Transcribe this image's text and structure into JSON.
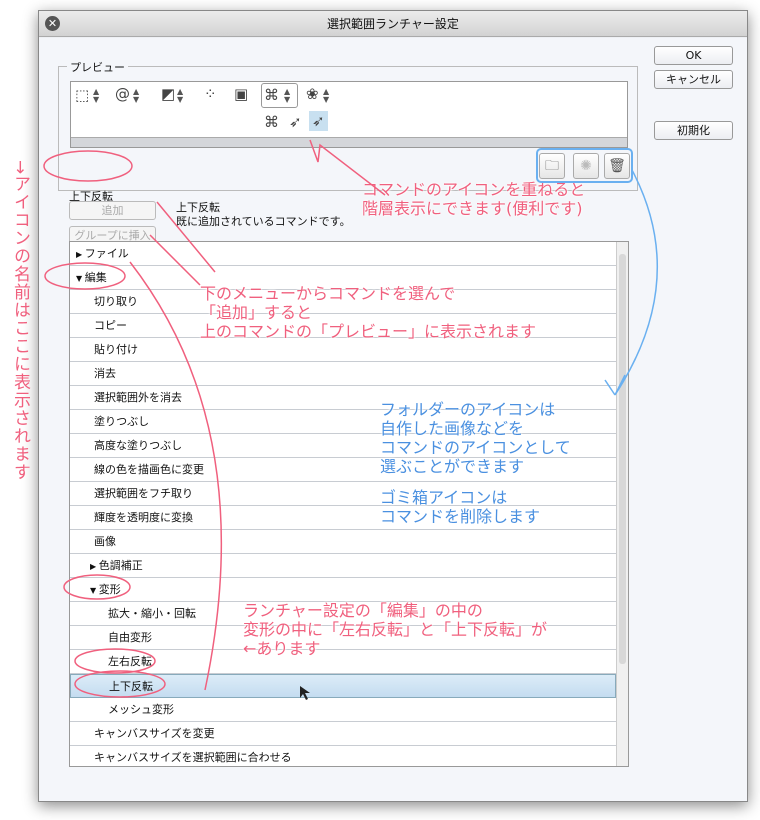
{
  "window": {
    "title": "選択範囲ランチャー設定"
  },
  "buttons": {
    "ok": "OK",
    "cancel": "キャンセル",
    "reset": "初期化",
    "add": "追加",
    "insert_group": "グループに挿入"
  },
  "preview": {
    "label": "プレビュー",
    "selected_name": "上下反転"
  },
  "description": {
    "name": "上下反転",
    "message": "既に追加されているコマンドです。"
  },
  "list": [
    {
      "label": "ファイル",
      "level": 0,
      "arrow": "right"
    },
    {
      "label": "編集",
      "level": 0,
      "arrow": "down"
    },
    {
      "label": "切り取り",
      "level": 1
    },
    {
      "label": "コピー",
      "level": 1
    },
    {
      "label": "貼り付け",
      "level": 1
    },
    {
      "label": "消去",
      "level": 1
    },
    {
      "label": "選択範囲外を消去",
      "level": 1
    },
    {
      "label": "塗りつぶし",
      "level": 1
    },
    {
      "label": "高度な塗りつぶし",
      "level": 1
    },
    {
      "label": "線の色を描画色に変更",
      "level": 1
    },
    {
      "label": "選択範囲をフチ取り",
      "level": 1
    },
    {
      "label": "輝度を透明度に変換",
      "level": 1
    },
    {
      "label": "画像",
      "level": 1
    },
    {
      "label": "色調補正",
      "level": 1,
      "arrow": "right"
    },
    {
      "label": "変形",
      "level": 1,
      "arrow": "down"
    },
    {
      "label": "拡大・縮小・回転",
      "level": 2
    },
    {
      "label": "自由変形",
      "level": 2
    },
    {
      "label": "左右反転",
      "level": 2
    },
    {
      "label": "上下反転",
      "level": 2,
      "selected": true
    },
    {
      "label": "メッシュ変形",
      "level": 2
    },
    {
      "label": "キャンバスサイズを変更",
      "level": 1
    },
    {
      "label": "キャンバスサイズを選択範囲に合わせる",
      "level": 1
    }
  ],
  "annotations": {
    "vertical": "→アイコンの名前はここに表示されます",
    "stack": [
      "コマンドのアイコンを重ねると",
      "階層表示にできます(便利です)"
    ],
    "add": [
      "下のメニューからコマンドを選んで",
      "「追加」すると",
      "上のコマンドの「プレビュー」に表示されます"
    ],
    "folder": [
      "フォルダーのアイコンは",
      "自作した画像などを",
      "コマンドのアイコンとして",
      "選ぶことができます"
    ],
    "trash": [
      "ゴミ箱アイコンは",
      "コマンドを削除します"
    ],
    "transform": [
      "ランチャー設定の「編集」の中の",
      "変形の中に「左右反転」と「上下反転」が",
      "←あります"
    ]
  },
  "colors": {
    "pink": "#f0607e",
    "blue": "#4a90e0",
    "selected": "#c4dcf0"
  }
}
